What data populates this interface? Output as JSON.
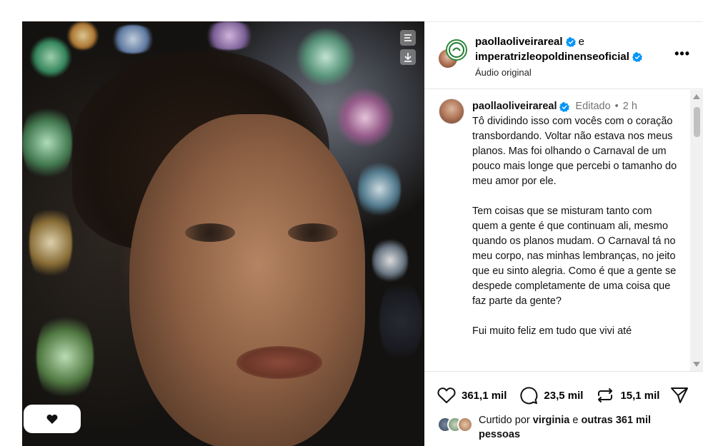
{
  "post": {
    "media_alt": "Close-up of a woman wearing a sparkling jeweled headpiece",
    "header": {
      "author_1": "paollaoliveirareal",
      "conjunction": "e",
      "author_2": "imperatrizleopoldinenseoficial",
      "audio": "Áudio original"
    },
    "caption": {
      "username": "paollaoliveirareal",
      "edited": "Editado",
      "separator": "•",
      "time": "2 h",
      "paragraphs": [
        "Tô dividindo isso com vocês com o coração transbordando. Voltar não estava nos meus planos. Mas foi olhando o Carnaval de um pouco mais longe que percebi o tamanho do meu amor por ele.",
        "Tem coisas que se misturam tanto com quem a gente é que continuam ali, mesmo quando os planos mudam. O Carnaval tá no meu corpo, nas minhas lembranças, no jeito que eu sinto alegria. Como é que a gente se despede completamente de uma coisa que faz parte da gente?",
        "Fui muito feliz em tudo que vivi até"
      ]
    },
    "stats": {
      "likes": "361,1 mil",
      "comments": "23,5 mil",
      "reposts": "15,1 mil"
    },
    "liked_by": {
      "prefix": "Curtido por",
      "user": "virginia",
      "conjunction": "e",
      "others": "outras 361 mil",
      "suffix": "pessoas"
    }
  },
  "icons": {
    "verified": "verified-badge-icon",
    "more": "more-options-icon",
    "heart": "heart-icon",
    "comment": "comment-icon",
    "repost": "repost-icon",
    "share": "share-icon",
    "media_menu": "lines-icon",
    "media_download": "download-icon"
  },
  "colors": {
    "verified_blue": "#0095f6",
    "meta_gray": "#737373",
    "border": "#e6e6e6"
  }
}
